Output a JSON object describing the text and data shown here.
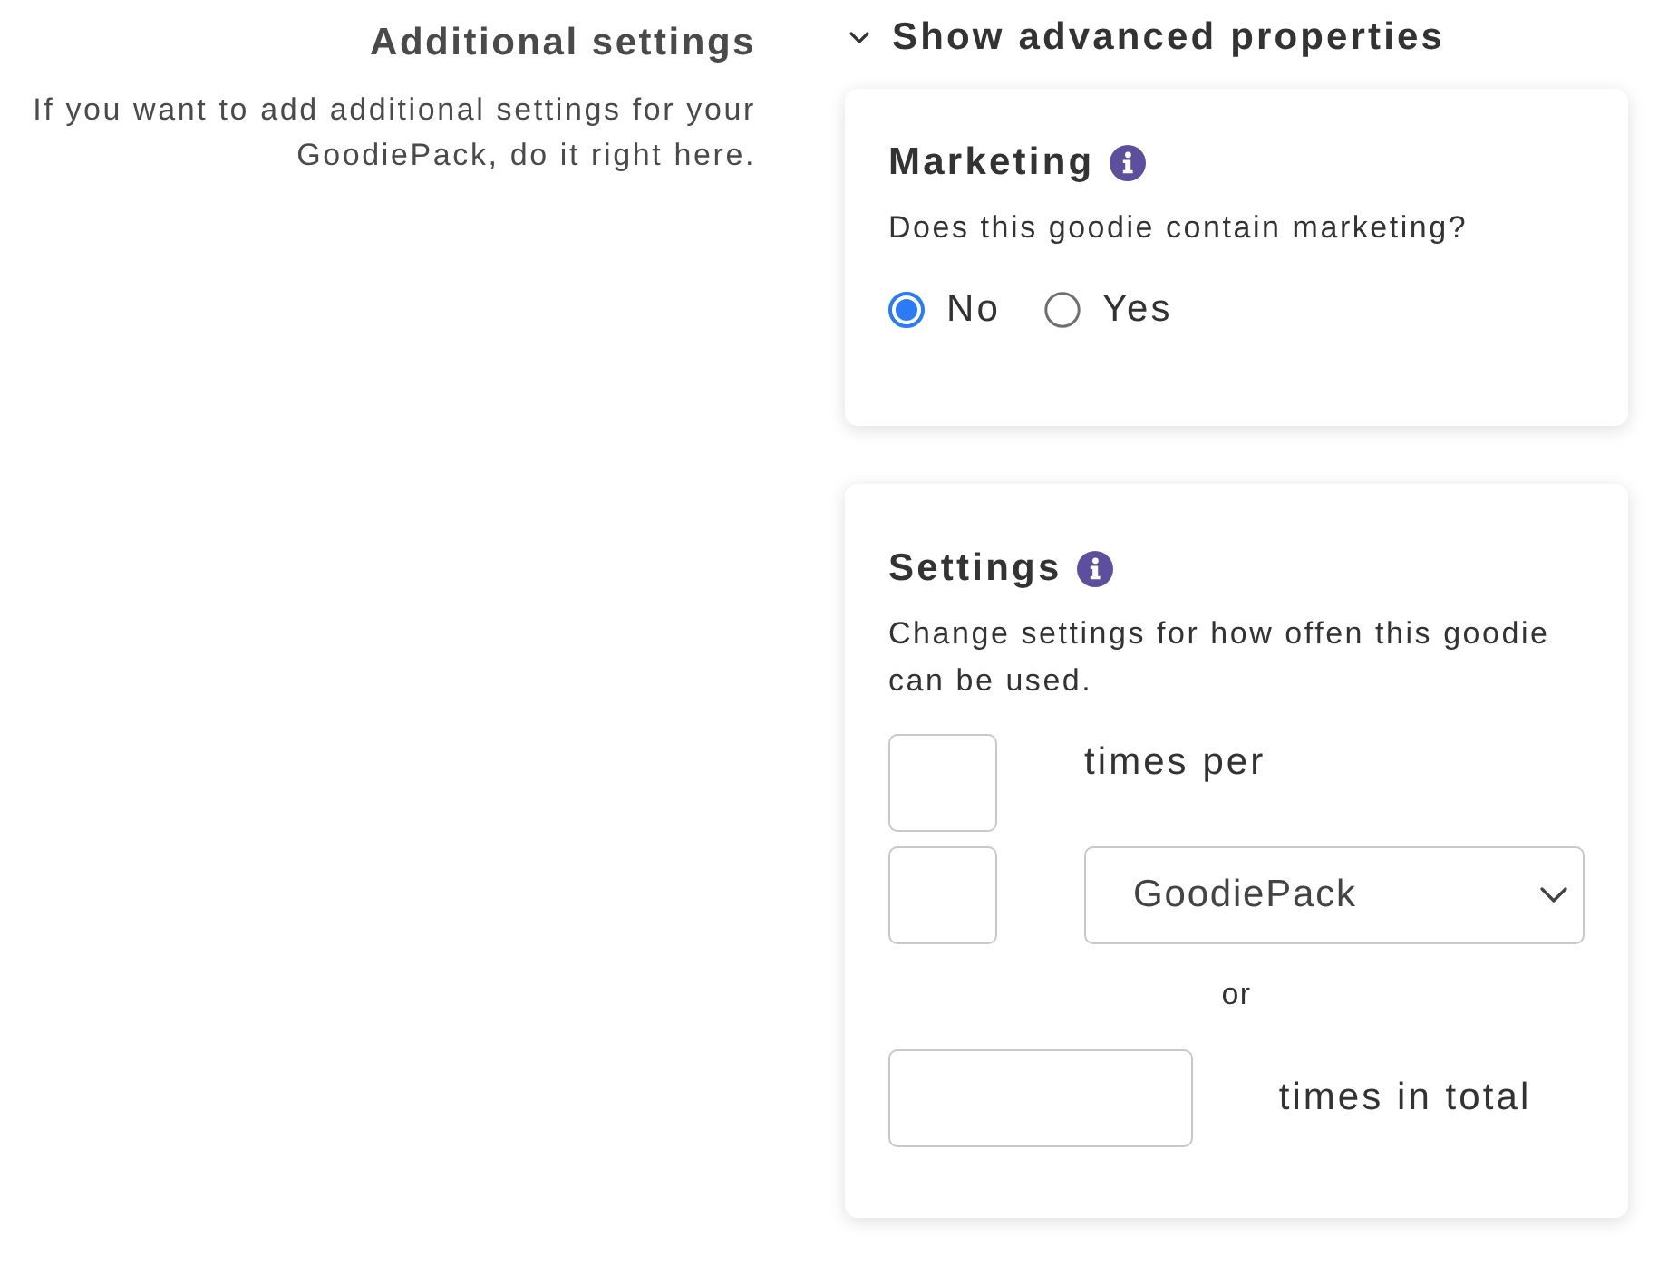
{
  "section": {
    "title": "Additional settings",
    "description": "If you want to add additional settings for your GoodiePack, do it right here."
  },
  "advanced_toggle": {
    "label": "Show advanced properties",
    "expanded": true
  },
  "cards": [
    {
      "kind": "radio",
      "title": "Marketing",
      "description": "Does this goodie contain marketing?",
      "options": [
        {
          "label": "No",
          "selected": true
        },
        {
          "label": "Yes",
          "selected": false
        }
      ]
    },
    {
      "kind": "limits",
      "title": "Settings",
      "description": "Change settings for how offen this goodie can be used.",
      "per_label": "times per",
      "period_select": {
        "value": "GoodiePack"
      },
      "separator": "or",
      "total_label": "times in total"
    }
  ]
}
